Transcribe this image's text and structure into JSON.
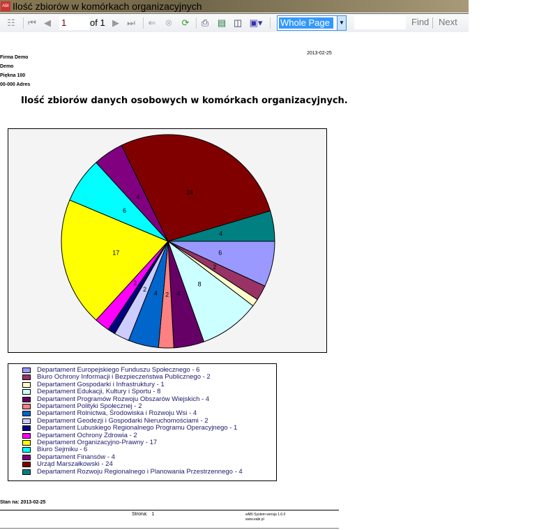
{
  "window": {
    "title": "Ilość zbiorów w komórkach organizacyjnych",
    "app_icon": "ABI"
  },
  "toolbar": {
    "page": "1",
    "of_label": "of",
    "total_pages": "1",
    "zoom": "Whole Page",
    "find": "Find",
    "next": "Next",
    "icons": [
      "document-map-icon",
      "first-page-icon",
      "prev-page-icon",
      "next-page-icon",
      "last-page-icon",
      "back-icon",
      "stop-icon",
      "refresh-icon",
      "print-icon",
      "page-layout-icon",
      "page-setup-icon",
      "save-icon"
    ]
  },
  "report": {
    "company": [
      "Firma Demo",
      "Demo",
      "Piękna 100",
      "00-000 Adres"
    ],
    "date": "2013-02-25",
    "title": "Ilość zbiorów danych osobowych w komórkach organizacyjnych.",
    "footer": {
      "stan": "Stan na: 2013-02-25",
      "strona_label": "Strona:",
      "strona": "1",
      "system": "eABI System wersja 1.6.0",
      "www": "www.eabi.pl"
    }
  },
  "chart_data": {
    "type": "pie",
    "start": "3 o'clock",
    "direction": "clockwise",
    "categories": [
      "Departament Europejskiego Funduszu Społecznego",
      "Biuro Ochrony Informacji i Bezpieczeństwa Publicznego",
      "Departament Gospodarki i Infrastruktury",
      "Departament Edukacji, Kultury i Sportu",
      "Departament Programów Rozwoju Obszarów Wiejskich",
      "Departament Polityki Społecznej",
      "Departament Rolnictwa, Środowiska i Rozwoju Wsi",
      "Departament Geodezji i Gospodarki Nieruchomościami",
      "Departament Lubuskiego Regionalnego Programu Operacyjnego",
      "Departament Ochrony Zdrowia",
      "Departament Organizacyjno-Prawny",
      "Biuro Sejmiku",
      "Departament Finansów",
      "Urząd Marszałkowski",
      "Departament Rozwoju Regionalnego i Planowania Przestrzennego"
    ],
    "values": [
      6,
      2,
      1,
      8,
      4,
      2,
      4,
      2,
      1,
      2,
      17,
      6,
      4,
      24,
      4
    ],
    "legend_labels": [
      "Departament Europejskiego Funduszu Społecznego - 6",
      "Biuro Ochrony Informacji i Bezpieczeństwa Publicznego - 2",
      "Departament Gospodarki i Infrastruktury - 1",
      "Departament Edukacji, Kultury i Sportu - 8",
      "Departament Programów Rozwoju Obszarów Wiejskich - 4",
      "Departament Polityki Społecznej - 2",
      "Departament Rolnictwa, Środowiska i Rozwoju Wsi - 4",
      "Departament Geodezji i Gospodarki Nieruchomościami - 2",
      "Departament Lubuskiego Regionalnego Programu Operacyjnego - 1",
      "Departament Ochrony Zdrowia - 2",
      "Departament Organizacyjno-Prawny - 17",
      "Biuro Sejmiku - 6",
      "Departament Finansów - 4",
      "Urząd Marszałkowski - 24",
      "Departament Rozwoju Regionalnego i Planowania Przestrzennego - 4"
    ],
    "colors": [
      "#9999FF",
      "#993366",
      "#FFFFCC",
      "#CCFFFF",
      "#660066",
      "#FF8080",
      "#0066CC",
      "#CCCCFF",
      "#000080",
      "#FF00FF",
      "#FFFF00",
      "#00FFFF",
      "#800080",
      "#800000",
      "#008080"
    ],
    "legend_placement": "bottom"
  }
}
